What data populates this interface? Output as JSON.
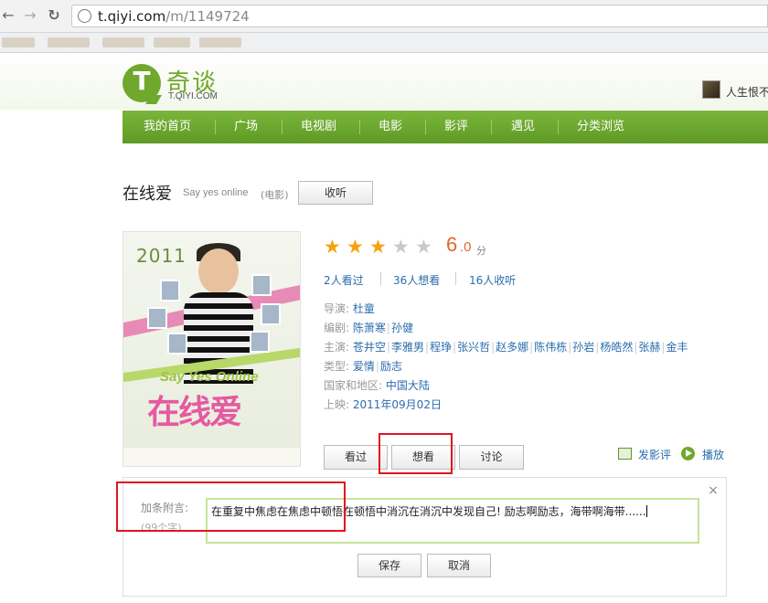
{
  "browser": {
    "back_glyph": "←",
    "forward_glyph": "→",
    "reload_glyph": "↻",
    "url_host": "t.qiyi.com",
    "url_path": "/m/1149724"
  },
  "site": {
    "logo_mark": "T",
    "logo_name": "奇谈",
    "logo_sub": "T.QIYI.COM",
    "user_name": "人生恨不"
  },
  "nav": {
    "items": [
      "我的首页",
      "广场",
      "电视剧",
      "电影",
      "影评",
      "遇见",
      "分类浏览"
    ]
  },
  "movie": {
    "title": "在线爱",
    "english_title": "Say yes online",
    "type": "(电影)",
    "listen_label": "收听",
    "poster": {
      "top_text": "2011",
      "say_yes": "Say Yes Online",
      "cn_title": "在线爱"
    },
    "rating": {
      "stars_filled": 3,
      "stars_total": 5,
      "integer": "6",
      "decimal": ".0",
      "unit": "分"
    },
    "stats": [
      "2人看过",
      "36人想看",
      "16人收听"
    ],
    "info": {
      "director_label": "导演:",
      "director": "杜童",
      "writer_label": "编剧:",
      "writers": [
        "陈萧寒",
        "孙健"
      ],
      "cast_label": "主演:",
      "cast": [
        "苍井空",
        "李雅男",
        "程琤",
        "张兴哲",
        "赵多娜",
        "陈伟栋",
        "孙岩",
        "杨皓然",
        "张赫",
        "金丰"
      ],
      "genre_label": "类型:",
      "genres": [
        "爱情",
        "励志"
      ],
      "region_label": "国家和地区:",
      "region": "中国大陆",
      "release_label": "上映:",
      "release": "2011年09月02日"
    },
    "actions": {
      "seen": "看过",
      "want": "想看",
      "discuss": "讨论",
      "review": "发影评",
      "play": "播放"
    }
  },
  "note": {
    "label": "加条附言:",
    "limit": "(99个字)",
    "value": "在重复中焦虑在焦虑中顿悟在顿悟中消沉在消沉中发现自己! 励志啊励志，海带啊海带......",
    "close_glyph": "×",
    "save": "保存",
    "cancel": "取消"
  },
  "colors": {
    "brand_green": "#6fa82d",
    "link_blue": "#2b6dad",
    "rating_orange": "#e7642a",
    "highlight_red": "#e0141f"
  }
}
